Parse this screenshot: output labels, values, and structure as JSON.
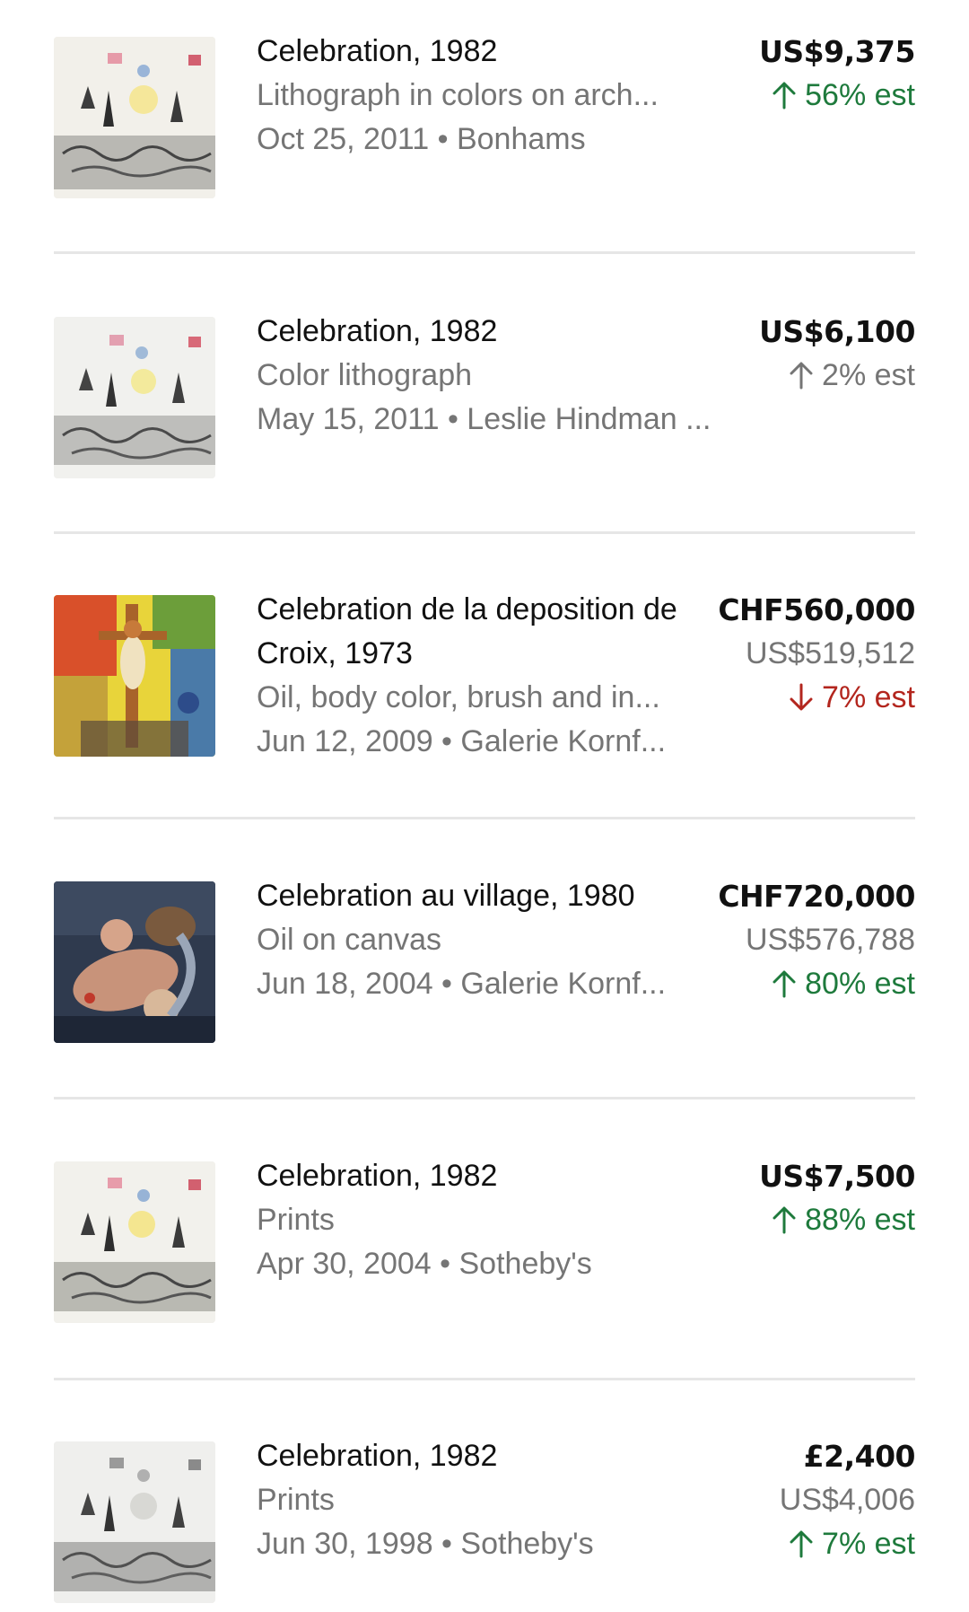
{
  "colors": {
    "up": "#1e7a3c",
    "down": "#b3261e",
    "neutral": "#757575",
    "text": "#111111",
    "muted": "#757575",
    "divider": "#e6e6e6"
  },
  "results": [
    {
      "title": "Celebration, 1982",
      "medium": "Lithograph in colors on arch...",
      "date_house": "Oct 25, 2011 • Bonhams",
      "price": "US$9,375",
      "price_usd": "",
      "estimate": "56% est",
      "direction": "up",
      "thumb_icon": "chagall-celebration-print-thumbnail"
    },
    {
      "title": "Celebration, 1982",
      "medium": "Color lithograph",
      "date_house": "May 15, 2011 • Leslie Hindman ...",
      "price": "US$6,100",
      "price_usd": "",
      "estimate": "2% est",
      "direction": "neutral",
      "thumb_icon": "chagall-celebration-print-thumbnail"
    },
    {
      "title": "Celebration de la deposition de Croix, 1973",
      "medium": "Oil, body color, brush and in...",
      "date_house": "Jun 12, 2009 • Galerie Kornf...",
      "price": "CHF560,000",
      "price_usd": "US$519,512",
      "estimate": "7% est",
      "direction": "down",
      "thumb_icon": "crucifixion-painting-thumbnail"
    },
    {
      "title": "Celebration au village, 1980",
      "medium": "Oil on canvas",
      "date_house": "Jun 18, 2004 • Galerie Kornf...",
      "price": "CHF720,000",
      "price_usd": "US$576,788",
      "estimate": "80% est",
      "direction": "up",
      "thumb_icon": "village-couple-painting-thumbnail"
    },
    {
      "title": "Celebration, 1982",
      "medium": "Prints",
      "date_house": "Apr 30, 2004 • Sotheby's",
      "price": "US$7,500",
      "price_usd": "",
      "estimate": "88% est",
      "direction": "up",
      "thumb_icon": "chagall-celebration-print-thumbnail"
    },
    {
      "title": "Celebration, 1982",
      "medium": "Prints",
      "date_house": "Jun 30, 1998 • Sotheby's",
      "price": "£2,400",
      "price_usd": "US$4,006",
      "estimate": "7% est",
      "direction": "up",
      "thumb_icon": "chagall-celebration-print-thumbnail"
    }
  ]
}
